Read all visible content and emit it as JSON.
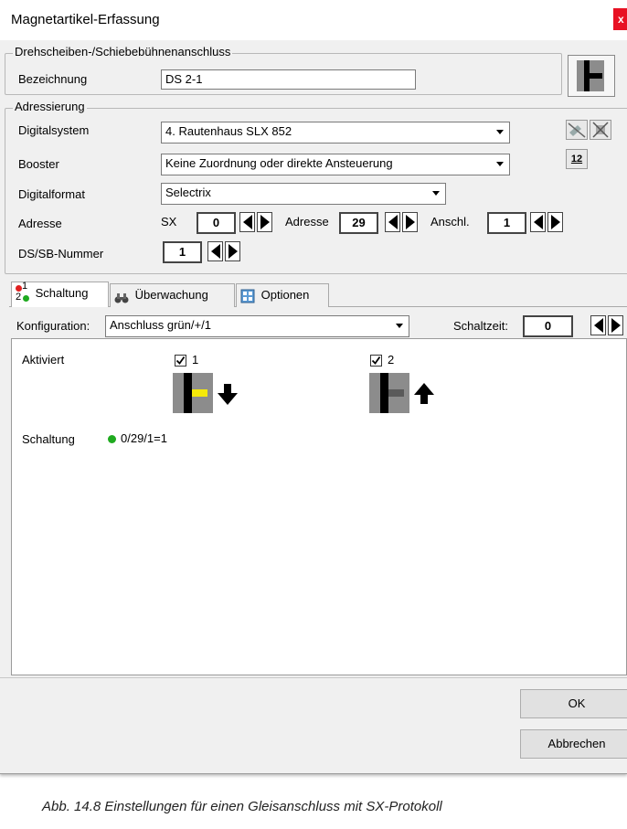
{
  "window": {
    "title": "Magnetartikel-Erfassung",
    "close_label": "x"
  },
  "connection_group": {
    "legend": "Drehscheiben-/Schiebebühnenanschluss",
    "name_label": "Bezeichnung",
    "name_value": "DS 2-1"
  },
  "addressing_group": {
    "legend": "Adressierung",
    "digital_system_label": "Digitalsystem",
    "digital_system_value": "4. Rautenhaus SLX 852",
    "booster_label": "Booster",
    "booster_value": "Keine Zuordnung oder direkte Ansteuerung",
    "format_label": "Digitalformat",
    "format_value": "Selectrix",
    "address_label": "Adresse",
    "sx_label": "SX",
    "sx_value": "0",
    "address2_label": "Adresse",
    "address2_value": "29",
    "anschl_label": "Anschl.",
    "anschl_value": "1",
    "dssb_label": "DS/SB-Nummer",
    "dssb_value": "1",
    "numbers_icon_text": "12"
  },
  "tabs": [
    {
      "label": "Schaltung",
      "icon_top": "1",
      "icon_bottom": "2"
    },
    {
      "label": "Überwachung"
    },
    {
      "label": "Optionen"
    }
  ],
  "config": {
    "label": "Konfiguration:",
    "value": "Anschluss grün/+/1",
    "switch_time_label": "Schaltzeit:",
    "switch_time_value": "0"
  },
  "panel": {
    "activated_label": "Aktiviert",
    "check1_label": "1",
    "check2_label": "2",
    "check1_checked": true,
    "check2_checked": true,
    "schaltung_label": "Schaltung",
    "schaltung_value": "0/29/1=1",
    "status_color": "#1faa1f",
    "active_color": "#f5e90a"
  },
  "buttons": {
    "ok": "OK",
    "cancel": "Abbrechen"
  },
  "caption": "Abb. 14.8    Einstellungen für einen Gleisanschluss mit SX-Protokoll"
}
